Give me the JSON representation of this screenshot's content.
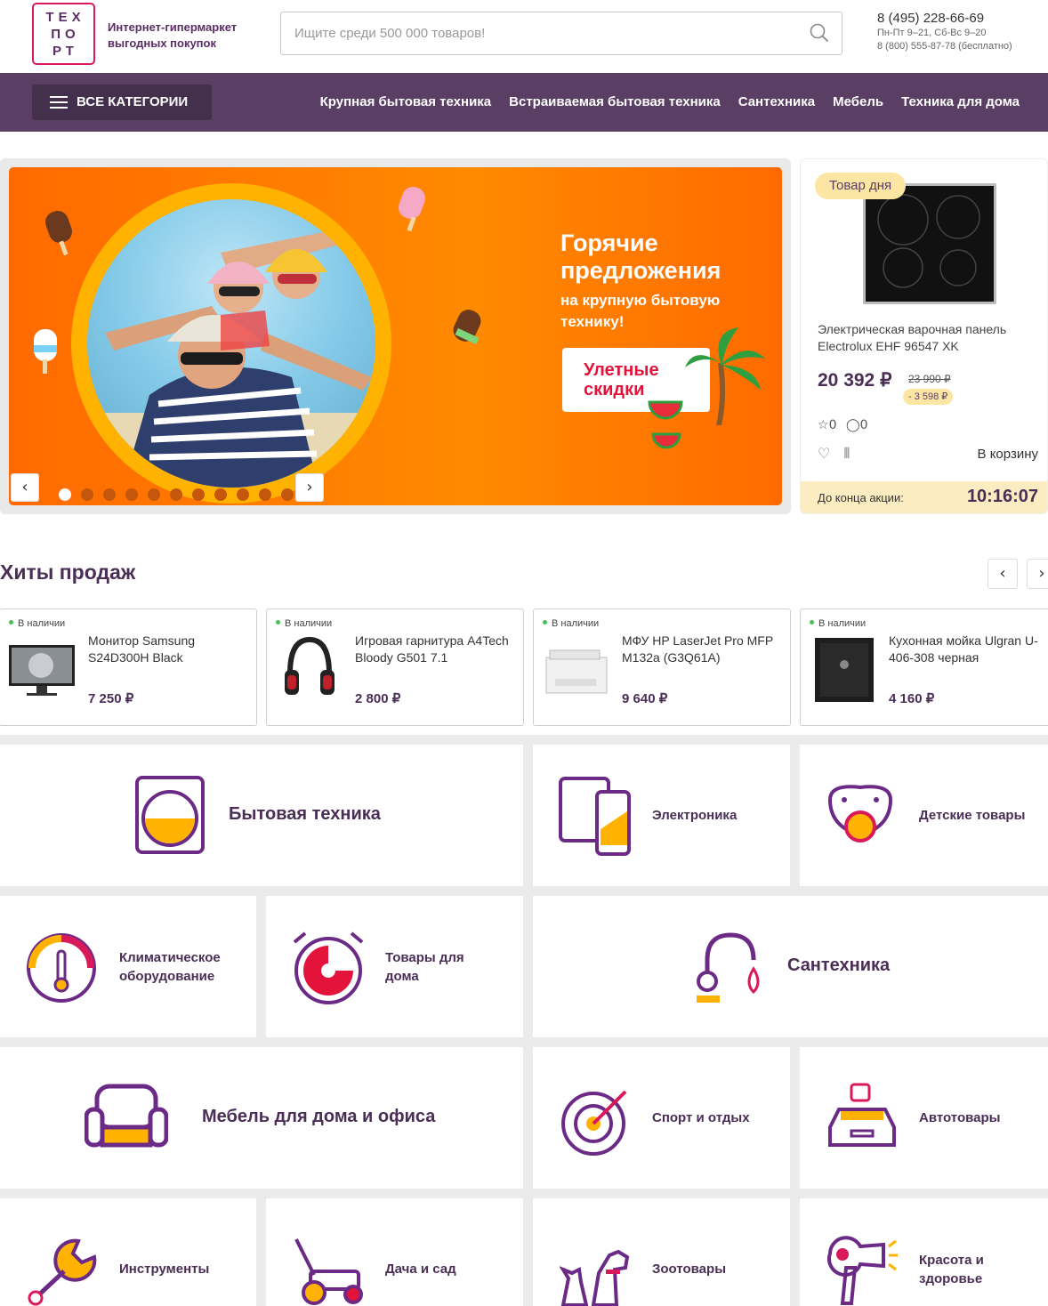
{
  "header": {
    "logo_lines": [
      "ТЕХ",
      "ПО",
      "РТ"
    ],
    "tagline": "Интернет-гипермаркет выгодных покупок",
    "search_placeholder": "Ищите среди 500 000 товаров!",
    "phone": "8 (495) 228-66-69",
    "hours": "Пн-Пт 9–21, Сб-Вс 9–20",
    "phone_free": "8 (800) 555-87-78 (бесплатно)"
  },
  "nav": {
    "all_categories": "ВСЕ КАТЕГОРИИ",
    "links": [
      "Крупная бытовая техника",
      "Встраиваемая бытовая техника",
      "Сантехника",
      "Мебель",
      "Техника для дома"
    ]
  },
  "banner": {
    "headline": "Горячие предложения",
    "subline": "на крупную бытовую технику!",
    "cta": "Улетные скидки",
    "slide_count": 11,
    "active_slide": 1
  },
  "deal": {
    "badge": "Товар дня",
    "name": "Электрическая варочная панель Electrolux EHF 96547 XK",
    "price": "20 392 ₽",
    "old_price": "23 990 ₽",
    "discount": "- 3 598 ₽",
    "rating": "0",
    "reviews": "0",
    "cart": "В корзину",
    "timer_label": "До конца акции:",
    "timer": "10:16:07"
  },
  "hits": {
    "title": "Хиты продаж",
    "items": [
      {
        "stock": "В наличии",
        "name": "Монитор Samsung S24D300H Black",
        "price": "7 250 ₽"
      },
      {
        "stock": "В наличии",
        "name": "Игровая гарнитура A4Tech Bloody G501 7.1",
        "price": "2 800 ₽"
      },
      {
        "stock": "В наличии",
        "name": "МФУ HP LaserJet Pro MFP M132a (G3Q61A)",
        "price": "9 640 ₽"
      },
      {
        "stock": "В наличии",
        "name": "Кухонная мойка Ulgran U-406-308 черная",
        "price": "4 160 ₽"
      }
    ]
  },
  "categories": [
    "Бытовая техника",
    "Электроника",
    "Детские товары",
    "Климатическое оборудование",
    "Товары для дома",
    "Сантехника",
    "Мебель для дома и офиса",
    "Спорт и отдых",
    "Автотовары",
    "Инструменты",
    "Дача и сад",
    "Зоотовары",
    "Красота и здоровье"
  ],
  "colors": {
    "brand_purple": "#5a3e64",
    "accent_orange": "#ff7a00",
    "accent_yellow": "#ffb300",
    "accent_red": "#e3133c"
  }
}
